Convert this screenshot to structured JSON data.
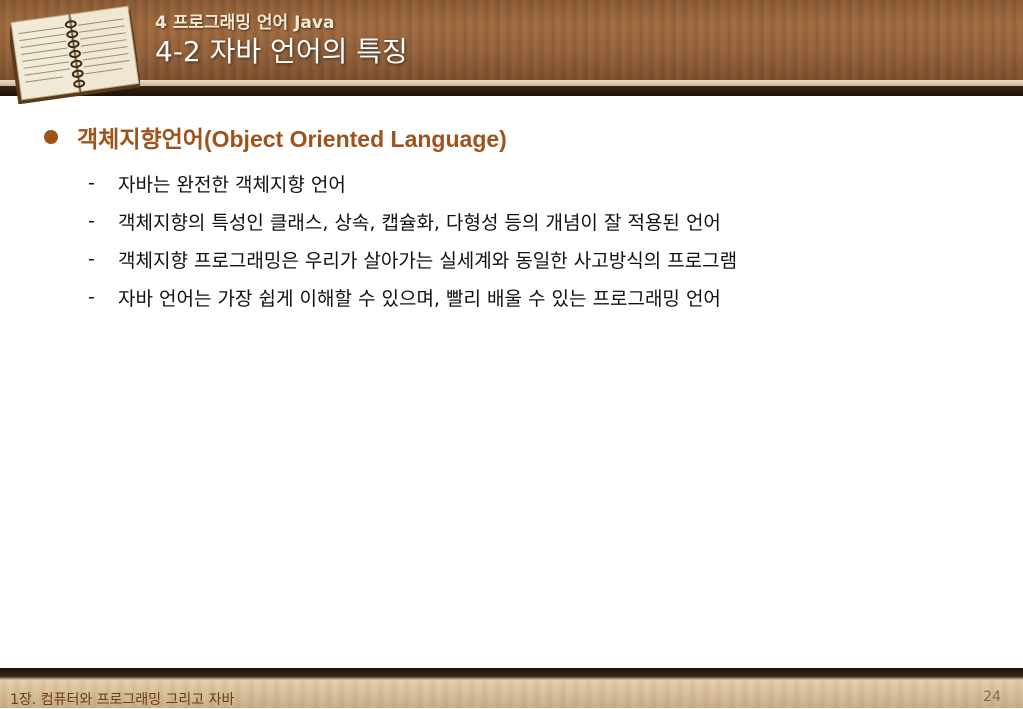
{
  "header": {
    "subtitle": "4 프로그래밍 언어 Java",
    "title": "4-2 자바 언어의 특징"
  },
  "main": {
    "bullet": "객체지향언어(Object Oriented Language)",
    "items": [
      "자바는 완전한 객체지향 언어",
      "객체지향의 특성인 클래스, 상속, 캡슐화, 다형성 등의 개념이 잘 적용된 언어",
      "객체지향 프로그래밍은 우리가 살아가는 실세계와 동일한 사고방식의 프로그램",
      "자바 언어는 가장 쉽게 이해할 수 있으며, 빨리 배울 수 있는 프로그래밍 언어"
    ],
    "dash": "-"
  },
  "footer": {
    "chapter": "1장. 컴퓨터와 프로그래밍 그리고 자바",
    "page": "24"
  },
  "colors": {
    "accent": "#a0521c",
    "wood": "#94613a"
  },
  "icons": {
    "header_image": "open-book-icon",
    "bullet": "filled-circle-bullet"
  }
}
